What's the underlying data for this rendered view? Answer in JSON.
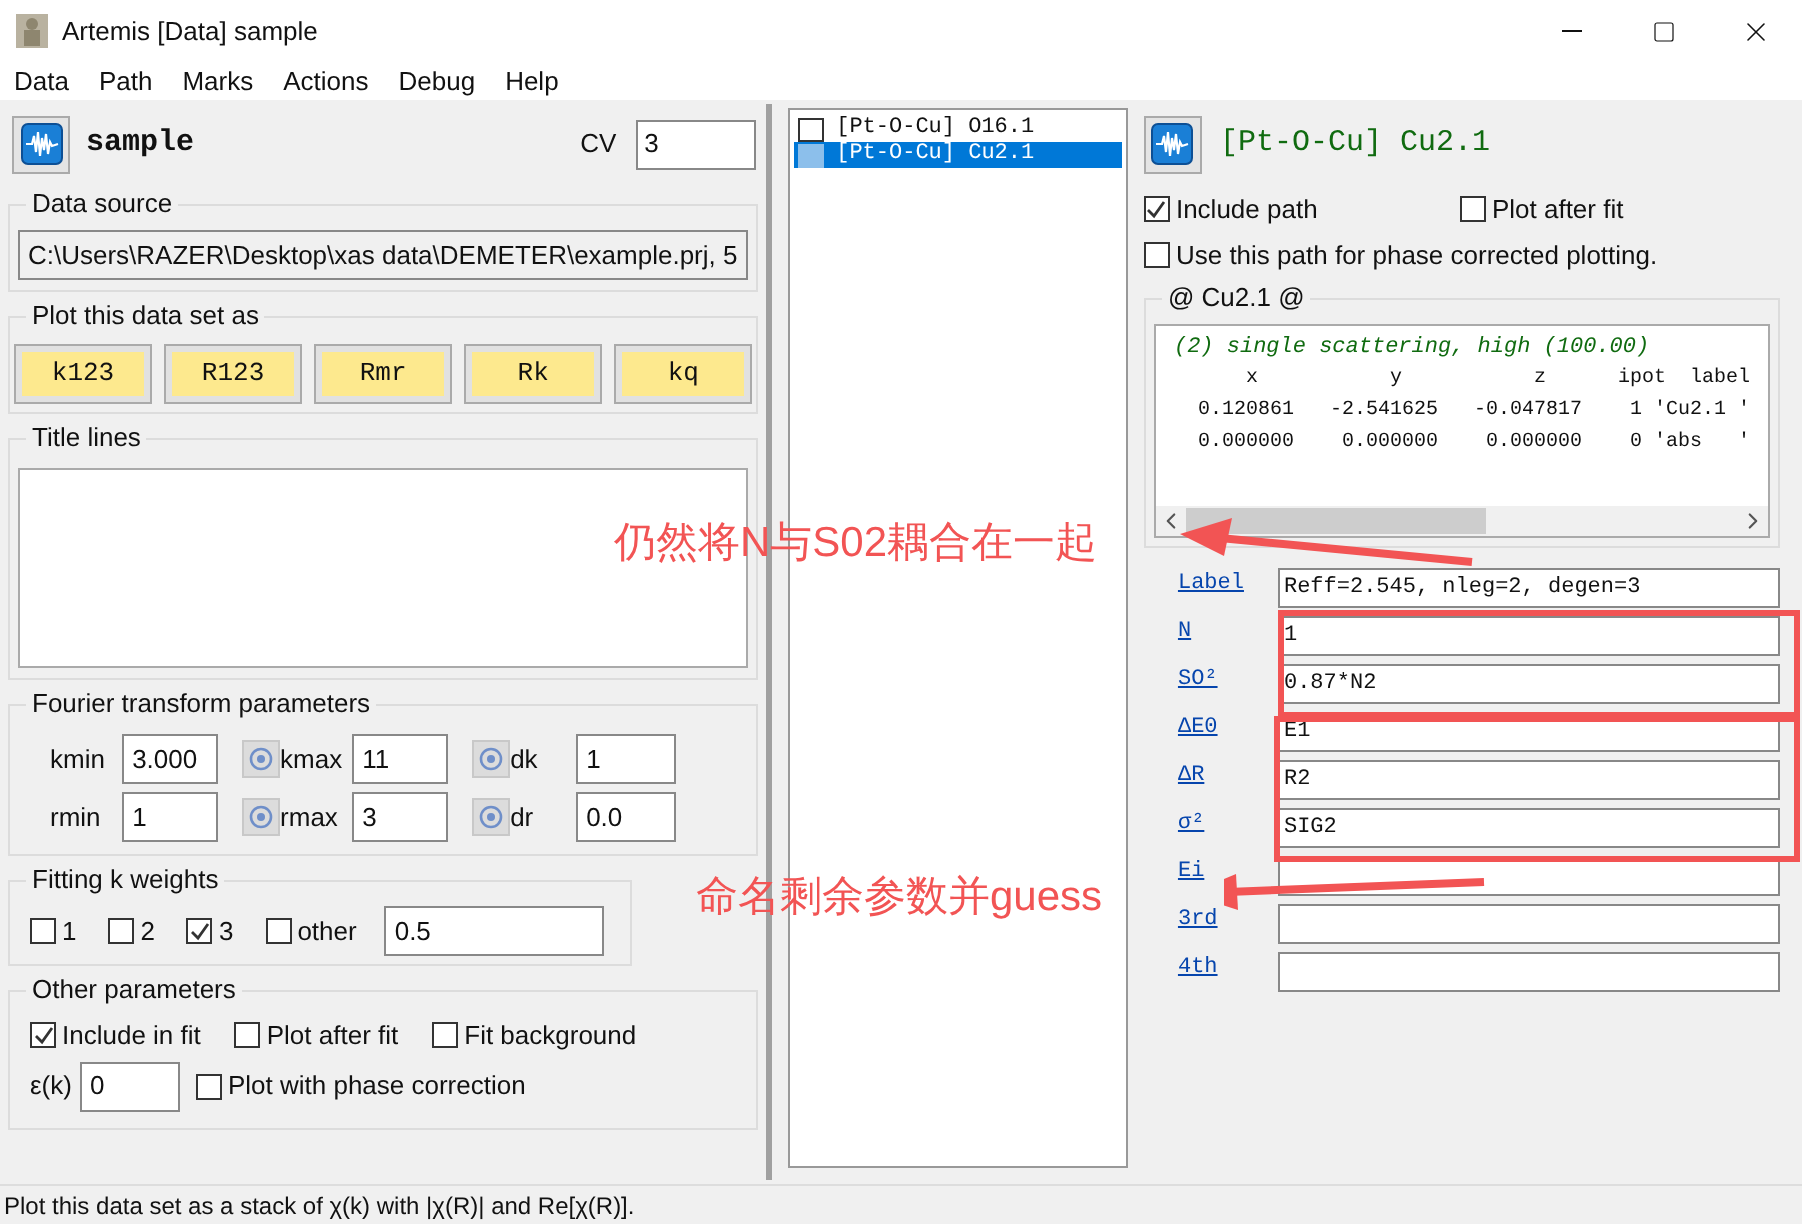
{
  "window": {
    "title": "Artemis [Data] sample"
  },
  "menu": [
    "Data",
    "Path",
    "Marks",
    "Actions",
    "Debug",
    "Help"
  ],
  "data_panel": {
    "name": "sample",
    "cv_label": "CV",
    "cv_value": "3",
    "data_source": {
      "title": "Data source",
      "value": "C:\\Users\\RAZER\\Desktop\\xas data\\DEMETER\\example.prj, 5"
    },
    "plot_as": {
      "title": "Plot this data set as",
      "buttons": [
        "k123",
        "R123",
        "Rmr",
        "Rk",
        "kq"
      ]
    },
    "title_lines": {
      "title": "Title lines"
    },
    "fourier": {
      "title": "Fourier transform parameters",
      "params": [
        {
          "label": "kmin",
          "value": "3.000",
          "kind": "pick"
        },
        {
          "label": "kmax",
          "value": "11",
          "kind": "pick"
        },
        {
          "label": "dk",
          "value": "1",
          "kind": "plain"
        },
        {
          "label": "rmin",
          "value": "1",
          "kind": "pick"
        },
        {
          "label": "rmax",
          "value": "3",
          "kind": "pick"
        },
        {
          "label": "dr",
          "value": "0.0",
          "kind": "plain"
        }
      ]
    },
    "k_weights": {
      "title": "Fitting k weights",
      "options": [
        {
          "label": "1",
          "checked": false
        },
        {
          "label": "2",
          "checked": false
        },
        {
          "label": "3",
          "checked": true
        },
        {
          "label": "other",
          "checked": false
        }
      ],
      "other_value": "0.5"
    },
    "other": {
      "title": "Other parameters",
      "options": [
        {
          "label": "Include in fit",
          "checked": true
        },
        {
          "label": "Plot after fit",
          "checked": false
        },
        {
          "label": "Fit background",
          "checked": false
        }
      ],
      "epsilon_label": "ε(k)",
      "epsilon_value": "0",
      "phase": {
        "label": "Plot with phase correction",
        "checked": false
      }
    }
  },
  "path_list": [
    {
      "label": "[Pt-O-Cu] O16.1",
      "checked": false,
      "selected": false
    },
    {
      "label": "[Pt-O-Cu] Cu2.1",
      "checked": false,
      "selected": true
    }
  ],
  "path_panel": {
    "title": "[Pt-O-Cu] Cu2.1",
    "options": [
      {
        "label": "Include path",
        "checked": true
      },
      {
        "label": "Plot after fit",
        "checked": false
      },
      {
        "label": "Use this path for phase corrected plotting.",
        "checked": false
      }
    ],
    "info": {
      "title": "@ Cu2.1  @",
      "heading": "(2) single scattering, high (100.00)",
      "lines": [
        "      x           y           z      ipot  label",
        "  0.120861   -2.541625   -0.047817    1 'Cu2.1 '",
        "  0.000000    0.000000    0.000000    0 'abs   '"
      ]
    },
    "fields": [
      {
        "label": "Label",
        "value": "Reff=2.545, nleg=2, degen=3"
      },
      {
        "label": "N",
        "value": "1"
      },
      {
        "label": "SO²",
        "value": "0.87*N2"
      },
      {
        "label": "ΔE0",
        "value": "E1"
      },
      {
        "label": "ΔR",
        "value": "R2"
      },
      {
        "label": "σ²",
        "value": "SIG2"
      },
      {
        "label": "Ei"
      },
      {
        "label": "3rd"
      },
      {
        "label": "4th"
      }
    ]
  },
  "annotations": [
    "仍然将N与S02耦合在一起",
    "命名剩余参数并guess"
  ],
  "status_bar": "Plot this data set as a stack of χ(k) with |χ(R)| and Re[χ(R)]."
}
